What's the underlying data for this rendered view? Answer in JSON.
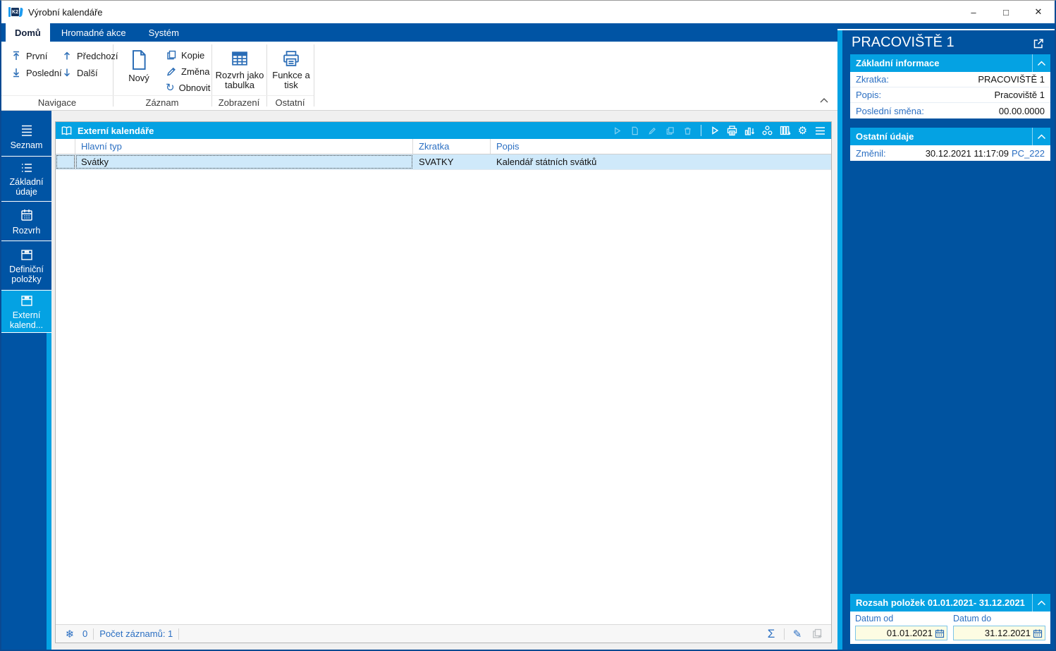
{
  "window": {
    "title": "Výrobní kalendáře",
    "logo_text": "K2",
    "controls": {
      "minimize": "–",
      "maximize": "□",
      "close": "✕"
    }
  },
  "tabs": [
    {
      "label": "Domů"
    },
    {
      "label": "Hromadné akce"
    },
    {
      "label": "Systém"
    }
  ],
  "ribbon": {
    "groups": [
      {
        "label": "Navigace"
      },
      {
        "label": "Záznam"
      },
      {
        "label": "Zobrazení"
      },
      {
        "label": "Ostatní"
      }
    ],
    "buttons": {
      "prvni": "První",
      "posledni": "Poslední",
      "predchozi": "Předchozí",
      "dalsi": "Další",
      "novy": "Nový",
      "kopie": "Kopie",
      "zmena": "Změna",
      "obnovit": "Obnovit",
      "rozvrh_tabulka": "Rozvrh jako tabulka",
      "funkce_tisk": "Funkce a tisk"
    }
  },
  "sidebar": {
    "items": [
      {
        "label": "Seznam"
      },
      {
        "label": "Základní údaje"
      },
      {
        "label": "Rozvrh"
      },
      {
        "label": "Definiční položky"
      },
      {
        "label": "Externí kalend..."
      }
    ],
    "active_label": "Externí kalend..."
  },
  "grid": {
    "title": "Externí kalendáře",
    "columns": [
      "Hlavní typ",
      "Zkratka",
      "Popis"
    ],
    "rows": [
      {
        "hlavni_typ": "Svátky",
        "zkratka": "SVATKY",
        "popis": "Kalendář státních svátků"
      }
    ],
    "status": {
      "frozen": "0",
      "count": "Počet záznamů: 1"
    }
  },
  "panel": {
    "title": "PRACOVIŠTĚ 1",
    "sections": [
      {
        "title": "Základní informace",
        "rows": [
          {
            "label": "Zkratka:",
            "value": "PRACOVIŠTĚ 1"
          },
          {
            "label": "Popis:",
            "value": "Pracoviště 1"
          },
          {
            "label": "Poslední směna:",
            "value": "00.00.0000"
          }
        ]
      },
      {
        "title": "Ostatní údaje",
        "rows": [
          {
            "label": "Změnil:",
            "value": "30.12.2021 11:17:09",
            "link": "PC_222"
          }
        ]
      }
    ],
    "range": {
      "title": "Rozsah položek 01.01.2021- 31.12.2021",
      "fields": [
        {
          "label": "Datum od",
          "value": "01.01.2021"
        },
        {
          "label": "Datum do",
          "value": "31.12.2021"
        }
      ]
    }
  },
  "icons": {
    "gear": "⚙",
    "snowflake": "❄",
    "pencil": "✎",
    "sigma": "Σ",
    "refresh": "↻"
  },
  "colors": {
    "dark_blue": "#0054a4",
    "accent_cyan": "#04a2e3",
    "icon_blue": "#2b6db6",
    "selection": "#cfe9fa",
    "input_yellow": "#fdfce3",
    "label_blue": "#2b6fc2"
  }
}
